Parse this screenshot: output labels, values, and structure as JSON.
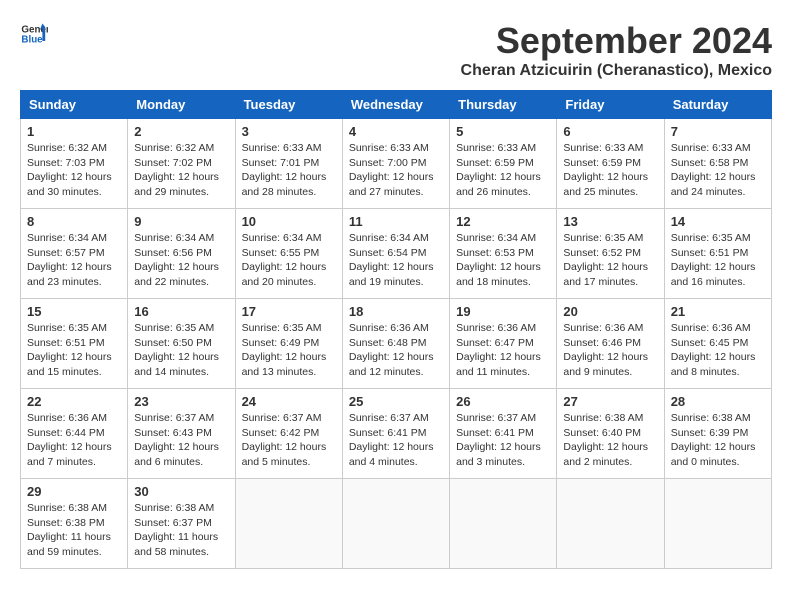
{
  "header": {
    "logo_general": "General",
    "logo_blue": "Blue",
    "month_title": "September 2024",
    "location": "Cheran Atzicuirin (Cheranastico), Mexico"
  },
  "days_of_week": [
    "Sunday",
    "Monday",
    "Tuesday",
    "Wednesday",
    "Thursday",
    "Friday",
    "Saturday"
  ],
  "weeks": [
    [
      {
        "day": "1",
        "sunrise": "6:32 AM",
        "sunset": "7:03 PM",
        "daylight": "12 hours and 30 minutes."
      },
      {
        "day": "2",
        "sunrise": "6:32 AM",
        "sunset": "7:02 PM",
        "daylight": "12 hours and 29 minutes."
      },
      {
        "day": "3",
        "sunrise": "6:33 AM",
        "sunset": "7:01 PM",
        "daylight": "12 hours and 28 minutes."
      },
      {
        "day": "4",
        "sunrise": "6:33 AM",
        "sunset": "7:00 PM",
        "daylight": "12 hours and 27 minutes."
      },
      {
        "day": "5",
        "sunrise": "6:33 AM",
        "sunset": "6:59 PM",
        "daylight": "12 hours and 26 minutes."
      },
      {
        "day": "6",
        "sunrise": "6:33 AM",
        "sunset": "6:59 PM",
        "daylight": "12 hours and 25 minutes."
      },
      {
        "day": "7",
        "sunrise": "6:33 AM",
        "sunset": "6:58 PM",
        "daylight": "12 hours and 24 minutes."
      }
    ],
    [
      {
        "day": "8",
        "sunrise": "6:34 AM",
        "sunset": "6:57 PM",
        "daylight": "12 hours and 23 minutes."
      },
      {
        "day": "9",
        "sunrise": "6:34 AM",
        "sunset": "6:56 PM",
        "daylight": "12 hours and 22 minutes."
      },
      {
        "day": "10",
        "sunrise": "6:34 AM",
        "sunset": "6:55 PM",
        "daylight": "12 hours and 20 minutes."
      },
      {
        "day": "11",
        "sunrise": "6:34 AM",
        "sunset": "6:54 PM",
        "daylight": "12 hours and 19 minutes."
      },
      {
        "day": "12",
        "sunrise": "6:34 AM",
        "sunset": "6:53 PM",
        "daylight": "12 hours and 18 minutes."
      },
      {
        "day": "13",
        "sunrise": "6:35 AM",
        "sunset": "6:52 PM",
        "daylight": "12 hours and 17 minutes."
      },
      {
        "day": "14",
        "sunrise": "6:35 AM",
        "sunset": "6:51 PM",
        "daylight": "12 hours and 16 minutes."
      }
    ],
    [
      {
        "day": "15",
        "sunrise": "6:35 AM",
        "sunset": "6:51 PM",
        "daylight": "12 hours and 15 minutes."
      },
      {
        "day": "16",
        "sunrise": "6:35 AM",
        "sunset": "6:50 PM",
        "daylight": "12 hours and 14 minutes."
      },
      {
        "day": "17",
        "sunrise": "6:35 AM",
        "sunset": "6:49 PM",
        "daylight": "12 hours and 13 minutes."
      },
      {
        "day": "18",
        "sunrise": "6:36 AM",
        "sunset": "6:48 PM",
        "daylight": "12 hours and 12 minutes."
      },
      {
        "day": "19",
        "sunrise": "6:36 AM",
        "sunset": "6:47 PM",
        "daylight": "12 hours and 11 minutes."
      },
      {
        "day": "20",
        "sunrise": "6:36 AM",
        "sunset": "6:46 PM",
        "daylight": "12 hours and 9 minutes."
      },
      {
        "day": "21",
        "sunrise": "6:36 AM",
        "sunset": "6:45 PM",
        "daylight": "12 hours and 8 minutes."
      }
    ],
    [
      {
        "day": "22",
        "sunrise": "6:36 AM",
        "sunset": "6:44 PM",
        "daylight": "12 hours and 7 minutes."
      },
      {
        "day": "23",
        "sunrise": "6:37 AM",
        "sunset": "6:43 PM",
        "daylight": "12 hours and 6 minutes."
      },
      {
        "day": "24",
        "sunrise": "6:37 AM",
        "sunset": "6:42 PM",
        "daylight": "12 hours and 5 minutes."
      },
      {
        "day": "25",
        "sunrise": "6:37 AM",
        "sunset": "6:41 PM",
        "daylight": "12 hours and 4 minutes."
      },
      {
        "day": "26",
        "sunrise": "6:37 AM",
        "sunset": "6:41 PM",
        "daylight": "12 hours and 3 minutes."
      },
      {
        "day": "27",
        "sunrise": "6:38 AM",
        "sunset": "6:40 PM",
        "daylight": "12 hours and 2 minutes."
      },
      {
        "day": "28",
        "sunrise": "6:38 AM",
        "sunset": "6:39 PM",
        "daylight": "12 hours and 0 minutes."
      }
    ],
    [
      {
        "day": "29",
        "sunrise": "6:38 AM",
        "sunset": "6:38 PM",
        "daylight": "11 hours and 59 minutes."
      },
      {
        "day": "30",
        "sunrise": "6:38 AM",
        "sunset": "6:37 PM",
        "daylight": "11 hours and 58 minutes."
      },
      null,
      null,
      null,
      null,
      null
    ]
  ]
}
